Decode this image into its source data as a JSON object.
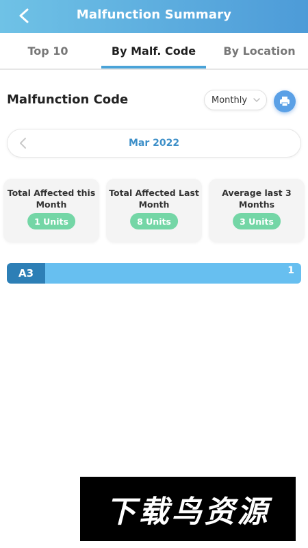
{
  "header": {
    "title": "Malfunction Summary",
    "back_icon": "back-arrow-icon",
    "gradient_start": "#6fc2e6",
    "gradient_end": "#4d9bd8"
  },
  "tabs": [
    {
      "label": "Top 10",
      "active": false
    },
    {
      "label": "By Malf. Code",
      "active": true
    },
    {
      "label": "By Location",
      "active": false
    }
  ],
  "section": {
    "title": "Malfunction Code",
    "period_select": {
      "value": "Monthly"
    },
    "print_icon": "print-icon"
  },
  "month_nav": {
    "label": "Mar 2022",
    "prev_icon": "chevron-left-icon"
  },
  "cards": [
    {
      "label": "Total Affected this Month",
      "value": "1 Units"
    },
    {
      "label": "Total Affected Last Month",
      "value": "8 Units"
    },
    {
      "label": "Average last 3 Months",
      "value": "3 Units"
    }
  ],
  "bars": [
    {
      "code": "A3",
      "value": "1"
    }
  ],
  "colors": {
    "accent": "#4aa3d8",
    "pill": "#74d6a6",
    "bar": "#67bff0",
    "bar_code": "#2d7fb6"
  },
  "watermark": {
    "text": "下载鸟资源"
  }
}
